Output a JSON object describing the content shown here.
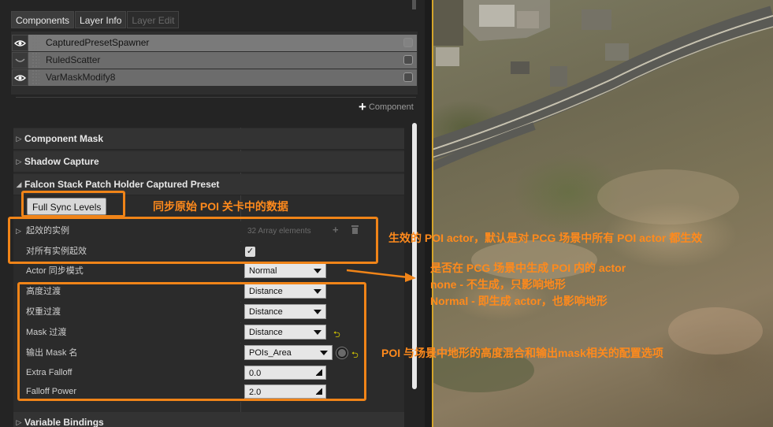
{
  "tabs": [
    {
      "label": "Components"
    },
    {
      "label": "Layer Info"
    },
    {
      "label": "Layer Edit"
    }
  ],
  "layers": [
    {
      "label": "CapturedPresetSpawner",
      "visible": true
    },
    {
      "label": "RuledScatter",
      "visible": false
    },
    {
      "label": "VarMaskModify8",
      "visible": true
    }
  ],
  "add_component_label": "Component",
  "sections": {
    "component_mask": "Component Mask",
    "shadow_capture": "Shadow Capture",
    "falcon_stack": "Falcon Stack Patch Holder Captured Preset",
    "variable_bindings": "Variable Bindings"
  },
  "full_sync_button": "Full Sync Levels",
  "props": {
    "effective_instances": {
      "label": "起效的实例",
      "value": "32 Array elements"
    },
    "all_instances_active": {
      "label": "对所有实例起效",
      "checked": true
    },
    "actor_sync_mode": {
      "label": "Actor 同步模式",
      "value": "Normal"
    },
    "height_transition": {
      "label": "高度过渡",
      "value": "Distance"
    },
    "weight_transition": {
      "label": "权重过渡",
      "value": "Distance"
    },
    "mask_transition": {
      "label": "Mask 过渡",
      "value": "Distance"
    },
    "output_mask_name": {
      "label": "输出 Mask 名",
      "value": "POIs_Area"
    },
    "extra_falloff": {
      "label": "Extra Falloff",
      "value": "0.0"
    },
    "falloff_power": {
      "label": "Falloff Power",
      "value": "2.0"
    }
  },
  "annotations": {
    "sync_note": "同步原始 POI 关卡中的数据",
    "effective_note": "生效的 POI actor，默认是对 PCG 场景中所有 POI actor 都生效",
    "generate_note_1": "是否在 PCG 场景中生成 POI 内的 actor",
    "generate_note_2": "none - 不生成，只影响地形",
    "generate_note_3": "Normal - 即生成 actor，也影响地形",
    "mask_note": "POI 与场景中地形的高度混合和输出mask相关的配置选项"
  },
  "colors": {
    "annotation": "#f08418",
    "annotation_text": "#ff8a1c",
    "panel_bg": "#242424",
    "viewport_divider": "#d4a52b"
  }
}
